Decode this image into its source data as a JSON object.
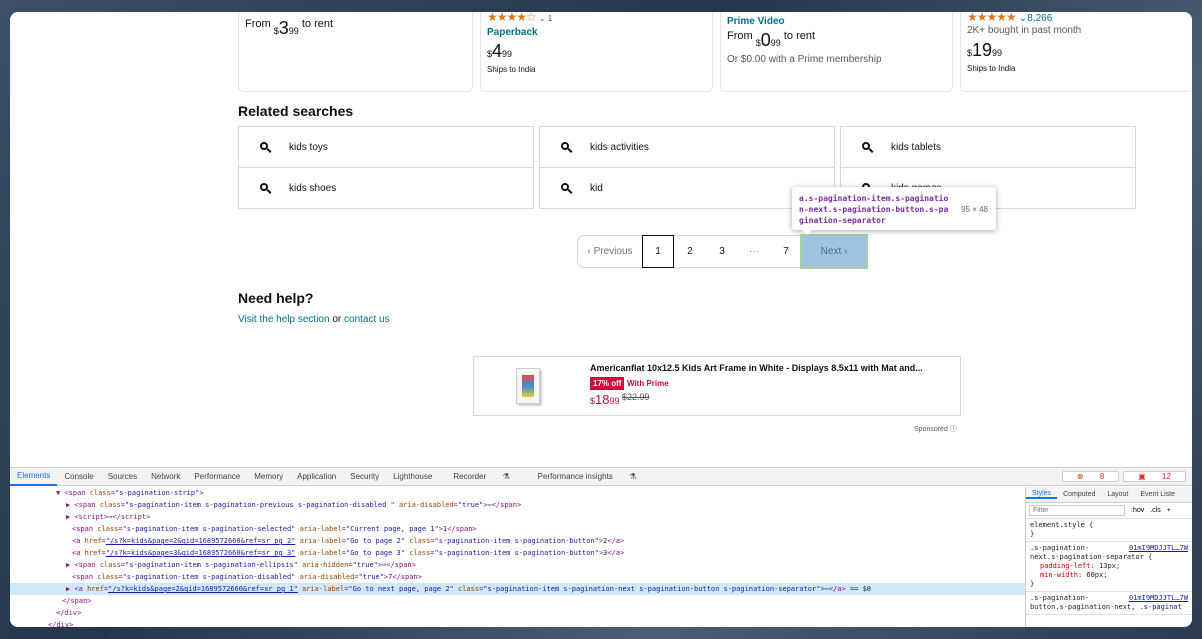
{
  "products": [
    {
      "from": "From",
      "dollar": "$",
      "price": "3",
      "cents": "99",
      "suffix": "to rent"
    },
    {
      "rating_count": "1",
      "format": "Paperback",
      "dollar": "$",
      "price": "4",
      "cents": "99",
      "ships": "Ships to India"
    },
    {
      "format": "Prime Video",
      "from": "From",
      "dollar": "$",
      "price": "0",
      "cents": "99",
      "suffix": "to rent",
      "note": "Or $0.00 with a Prime membership"
    },
    {
      "rating_count": "8,266",
      "bought": "2K+ bought in past month",
      "dollar": "$",
      "price": "19",
      "cents": "99",
      "ships": "Ships to India"
    }
  ],
  "related": {
    "title": "Related searches",
    "items": [
      "kids toys",
      "kids activities",
      "kids tablets",
      "kids shoes",
      "kid",
      "kids games"
    ]
  },
  "pagination": {
    "previous": "Previous",
    "pages": [
      "1",
      "2",
      "3"
    ],
    "ellipsis": "···",
    "last": "7",
    "next": "Next"
  },
  "tooltip": {
    "selector": "a.s-pagination-item.s-pagination-next.s-pagination-button.s-pagination-separator",
    "size": "95 × 48"
  },
  "help": {
    "title": "Need help?",
    "link1": "Visit the help section",
    "or": "or",
    "link2": "contact us"
  },
  "ad": {
    "title": "Americanflat 10x12.5 Kids Art Frame in White - Displays 8.5x11 with Mat and...",
    "discount": "17% off",
    "deal": "With Prime",
    "dollar": "$",
    "price": "18",
    "cents": "99",
    "list_price": "$22.99",
    "sponsored": "Sponsored"
  },
  "devtools": {
    "tabs": [
      "Elements",
      "Console",
      "Sources",
      "Network",
      "Performance",
      "Memory",
      "Application",
      "Security",
      "Lighthouse",
      "Recorder",
      "Performance insights"
    ],
    "errors": "8",
    "warnings": "12",
    "styles_tabs": [
      "Styles",
      "Computed",
      "Layout",
      "Event Liste"
    ],
    "filter_placeholder": "Filter",
    "hov": ":hov",
    "cls": ".cls",
    "element_style": "element.style {",
    "rule1_sel": ".s-pagination-",
    "rule1_src": "01mI9MDJJTL…7W",
    "rule1_sel2": "next.s-pagination-separator {",
    "rule1_p1": "padding-left",
    "rule1_v1": "13px;",
    "rule1_p2": "min-width",
    "rule1_v2": "60px;",
    "rule2_sel": ".s-pagination-",
    "rule2_src": "01mI9MDJJTL…7W",
    "rule2_sel2": "button.s-pagination-next, .s-paginat"
  }
}
